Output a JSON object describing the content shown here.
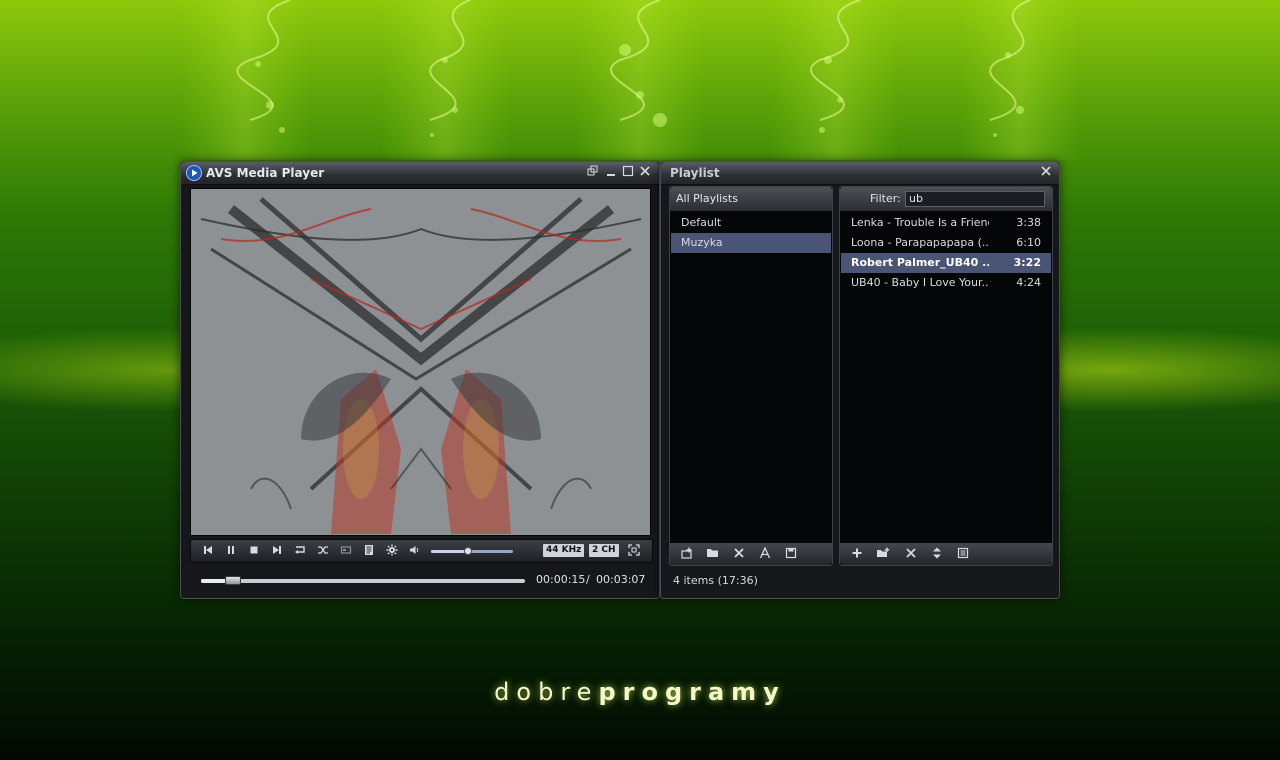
{
  "player": {
    "title": "AVS Media Player",
    "badges": {
      "khz": "44 KHz",
      "channels": "2 CH"
    },
    "volume": 0.45,
    "seek": 0.1,
    "time": {
      "current": "00:00:15",
      "separator": "/",
      "total": "00:03:07"
    },
    "icons": [
      "prev-icon",
      "pause-icon",
      "stop-icon",
      "next-icon",
      "repeat-icon",
      "shuffle-icon",
      "screenshot-icon",
      "playlist-icon",
      "settings-icon",
      "volume-icon",
      "fullscreen-icon"
    ]
  },
  "playlist": {
    "title": "Playlist",
    "all_playlists_label": "All Playlists",
    "playlists": [
      {
        "name": "Default",
        "selected": false
      },
      {
        "name": "Muzyka",
        "selected": true
      }
    ],
    "filter": {
      "label": "Filter:",
      "value": "ub"
    },
    "tracks": [
      {
        "name": "Lenka - Trouble Is a Friend",
        "duration": "3:38"
      },
      {
        "name": "Loona - Parapapapapa (...",
        "duration": "6:10"
      },
      {
        "name": "Robert Palmer_UB40 ...",
        "duration": "3:22"
      },
      {
        "name": "UB40 - Baby I Love Your...",
        "duration": "4:24"
      }
    ],
    "status": "4 items (17:36)"
  },
  "footer_logo": {
    "part1": "dobre",
    "part2": "programy"
  },
  "colors": {
    "accent": "#4a5474",
    "background": "#1b5b06"
  }
}
